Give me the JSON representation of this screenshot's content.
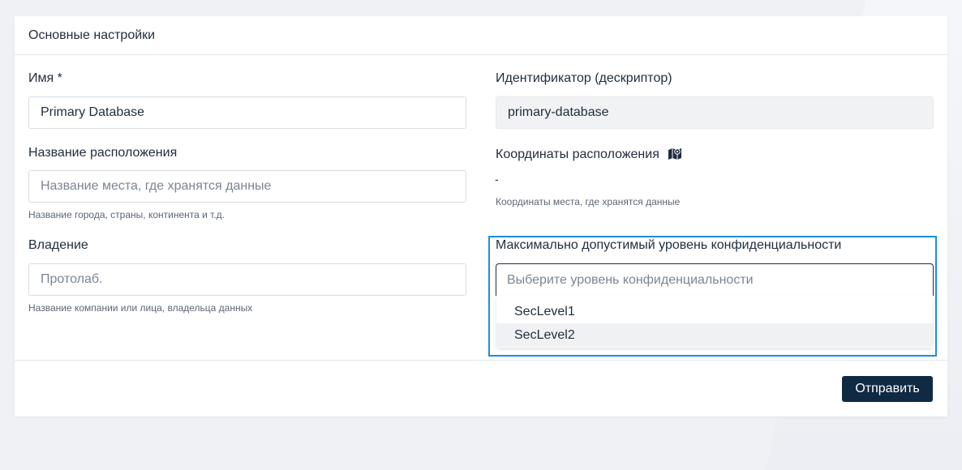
{
  "card": {
    "title": "Основные настройки"
  },
  "fields": {
    "name": {
      "label": "Имя *",
      "value": "Primary Database"
    },
    "identifier": {
      "label": "Идентификатор (дескриптор)",
      "value": "primary-database"
    },
    "location_name": {
      "label": "Название расположения",
      "placeholder": "Название места, где хранятся данные",
      "hint": "Название города, страны, континента и т.д."
    },
    "coordinates": {
      "label": "Координаты расположения",
      "icon": "map-marker-icon",
      "value": "-",
      "hint": "Координаты места, где хранятся данные"
    },
    "ownership": {
      "label": "Владение",
      "placeholder": "Протолаб.",
      "hint": "Название компании или лица, владельца данных"
    },
    "confidentiality": {
      "label": "Максимально допустимый уровень конфиденциальности",
      "placeholder": "Выберите уровень конфиденциальности",
      "options": [
        "SecLevel1",
        "SecLevel2"
      ],
      "highlighted": "SecLevel2"
    }
  },
  "footer": {
    "submit_label": "Отправить"
  },
  "colors": {
    "primary_button": "#102a43",
    "focus_border": "#1a8fe3",
    "readonly_bg": "#f1f2f4"
  }
}
